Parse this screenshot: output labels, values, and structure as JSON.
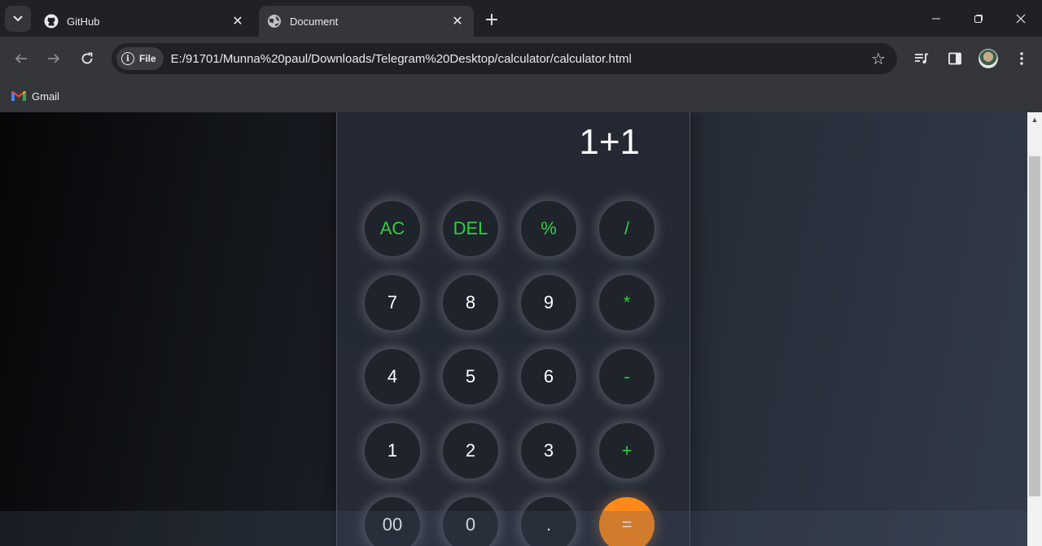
{
  "browser": {
    "tabs": [
      {
        "title": "GitHub",
        "active": false,
        "icon": "github-icon"
      },
      {
        "title": "Document",
        "active": true,
        "icon": "globe-icon"
      }
    ],
    "url_chip": "File",
    "url": "E:/91701/Munna%20paul/Downloads/Telegram%20Desktop/calculator/calculator.html",
    "bookmarks": [
      {
        "label": "Gmail",
        "icon": "gmail-icon"
      }
    ]
  },
  "calculator": {
    "display": "1+1",
    "keys": [
      {
        "label": "AC",
        "style": "green"
      },
      {
        "label": "DEL",
        "style": "green"
      },
      {
        "label": "%",
        "style": "green"
      },
      {
        "label": "/",
        "style": "green"
      },
      {
        "label": "7",
        "style": "white"
      },
      {
        "label": "8",
        "style": "white"
      },
      {
        "label": "9",
        "style": "white"
      },
      {
        "label": "*",
        "style": "green"
      },
      {
        "label": "4",
        "style": "white"
      },
      {
        "label": "5",
        "style": "white"
      },
      {
        "label": "6",
        "style": "white"
      },
      {
        "label": "-",
        "style": "green"
      },
      {
        "label": "1",
        "style": "white"
      },
      {
        "label": "2",
        "style": "white"
      },
      {
        "label": "3",
        "style": "white"
      },
      {
        "label": "+",
        "style": "green"
      },
      {
        "label": "00",
        "style": "white"
      },
      {
        "label": "0",
        "style": "white"
      },
      {
        "label": ".",
        "style": "white"
      },
      {
        "label": "=",
        "style": "orange"
      }
    ]
  },
  "colors": {
    "operator_text": "#2fd03f",
    "equals_button": "#ff8a1a",
    "key_background": "#1f232b"
  }
}
